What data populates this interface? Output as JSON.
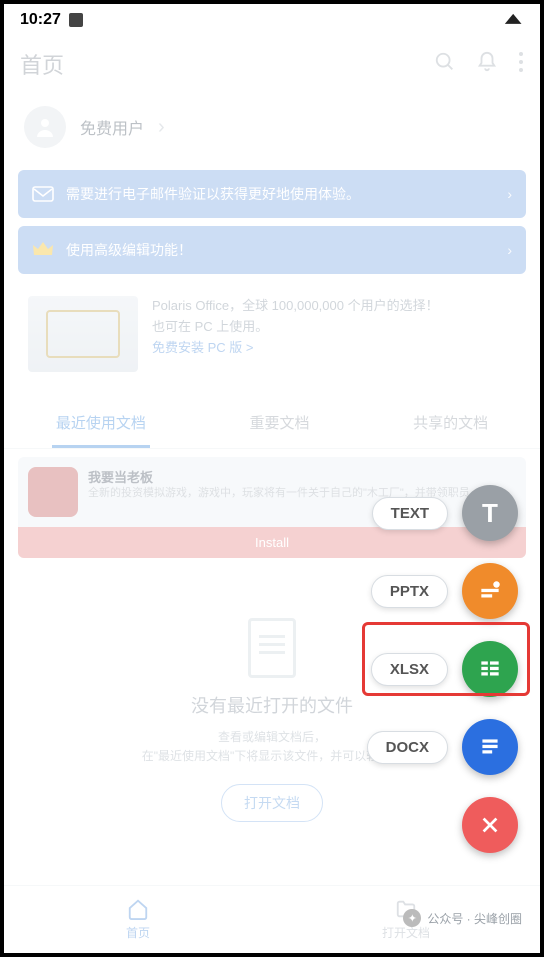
{
  "status": {
    "time": "10:27"
  },
  "header": {
    "title": "首页"
  },
  "user": {
    "label": "免费用户"
  },
  "banners": {
    "email": "需要进行电子邮件验证以获得更好地使用体验。",
    "premium": "使用高级编辑功能！"
  },
  "promo": {
    "line1": "Polaris Office，全球 100,000,000 个用户的选择！",
    "line2": "也可在 PC 上使用。",
    "link": "免费安装 PC 版 >"
  },
  "tabs": {
    "recent": "最近使用文档",
    "important": "重要文档",
    "shared": "共享的文档"
  },
  "ad": {
    "title": "我要当老板",
    "desc": "全新的投资模拟游戏，游戏中，玩家将有一件关于自己的\"木工厂\"，并带领职员…",
    "install": "Install"
  },
  "empty": {
    "title": "没有最近打开的文件",
    "sub1": "查看或编辑文档后，",
    "sub2": "在\"最近使用文档\"下将显示该文件，并可以轻松…",
    "open": "打开文档"
  },
  "nav": {
    "home": "首页",
    "open": "打开文档"
  },
  "fab": {
    "text": "TEXT",
    "pptx": "PPTX",
    "xlsx": "XLSX",
    "docx": "DOCX"
  },
  "watermark": "公众号 · 尖峰创圈"
}
